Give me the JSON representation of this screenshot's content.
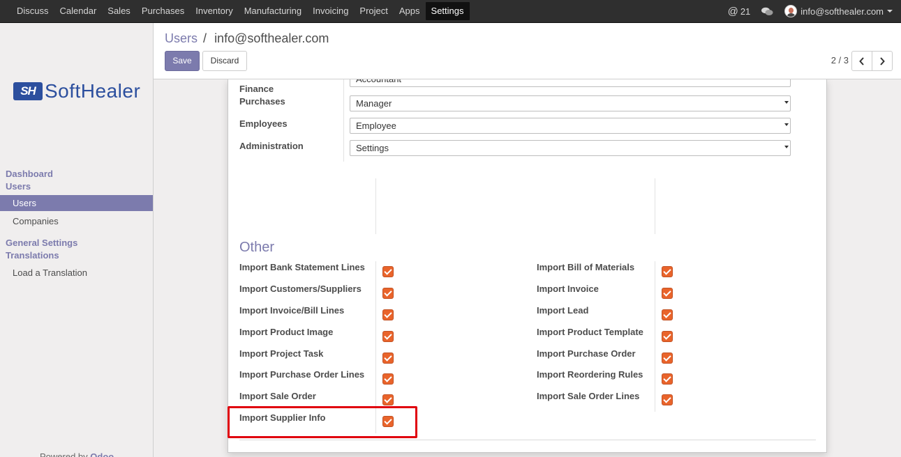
{
  "topbar": {
    "menu": [
      "Discuss",
      "Calendar",
      "Sales",
      "Purchases",
      "Inventory",
      "Manufacturing",
      "Invoicing",
      "Project",
      "Apps",
      "Settings"
    ],
    "active": "Settings",
    "mentions_count": "21",
    "user": "info@softhealer.com"
  },
  "sidebar": {
    "logo_mark": "SH",
    "logo_text": "SoftHealer",
    "sections": {
      "dashboard": "Dashboard",
      "users": "Users",
      "general_settings": "General Settings",
      "translations": "Translations"
    },
    "items": {
      "users": "Users",
      "companies": "Companies",
      "load_translation": "Load a Translation"
    },
    "powered_by": "Powered by",
    "powered_brand": "Odoo"
  },
  "control_panel": {
    "breadcrumb_root": "Users",
    "breadcrumb_sep": "/",
    "breadcrumb_current": "info@softhealer.com",
    "save_label": "Save",
    "discard_label": "Discard",
    "pager": "2 / 3"
  },
  "access_rights": {
    "partial_select_value": "Accountant",
    "rows": [
      {
        "label": "Finance",
        "value": ""
      },
      {
        "label": "Purchases",
        "value": "Manager"
      },
      {
        "label": "Employees",
        "value": "Employee"
      },
      {
        "label": "Administration",
        "value": "Settings"
      }
    ]
  },
  "other": {
    "title": "Other",
    "left": [
      {
        "label": "Import Bank Statement Lines",
        "checked": true
      },
      {
        "label": "Import Customers/Suppliers",
        "checked": true
      },
      {
        "label": "Import Invoice/Bill Lines",
        "checked": true
      },
      {
        "label": "Import Product Image",
        "checked": true
      },
      {
        "label": "Import Project Task",
        "checked": true
      },
      {
        "label": "Import Purchase Order Lines",
        "checked": true
      },
      {
        "label": "Import Sale Order",
        "checked": true
      },
      {
        "label": "Import Supplier Info",
        "checked": true
      }
    ],
    "right": [
      {
        "label": "Import Bill of Materials",
        "checked": true
      },
      {
        "label": "Import Invoice",
        "checked": true
      },
      {
        "label": "Import Lead",
        "checked": true
      },
      {
        "label": "Import Product Template",
        "checked": true
      },
      {
        "label": "Import Purchase Order",
        "checked": true
      },
      {
        "label": "Import Reordering Rules",
        "checked": true
      },
      {
        "label": "Import Sale Order Lines",
        "checked": true
      }
    ]
  },
  "colors": {
    "brand": "#7c7bad",
    "checkbox": "#e9642b",
    "highlight": "#e0000d"
  }
}
